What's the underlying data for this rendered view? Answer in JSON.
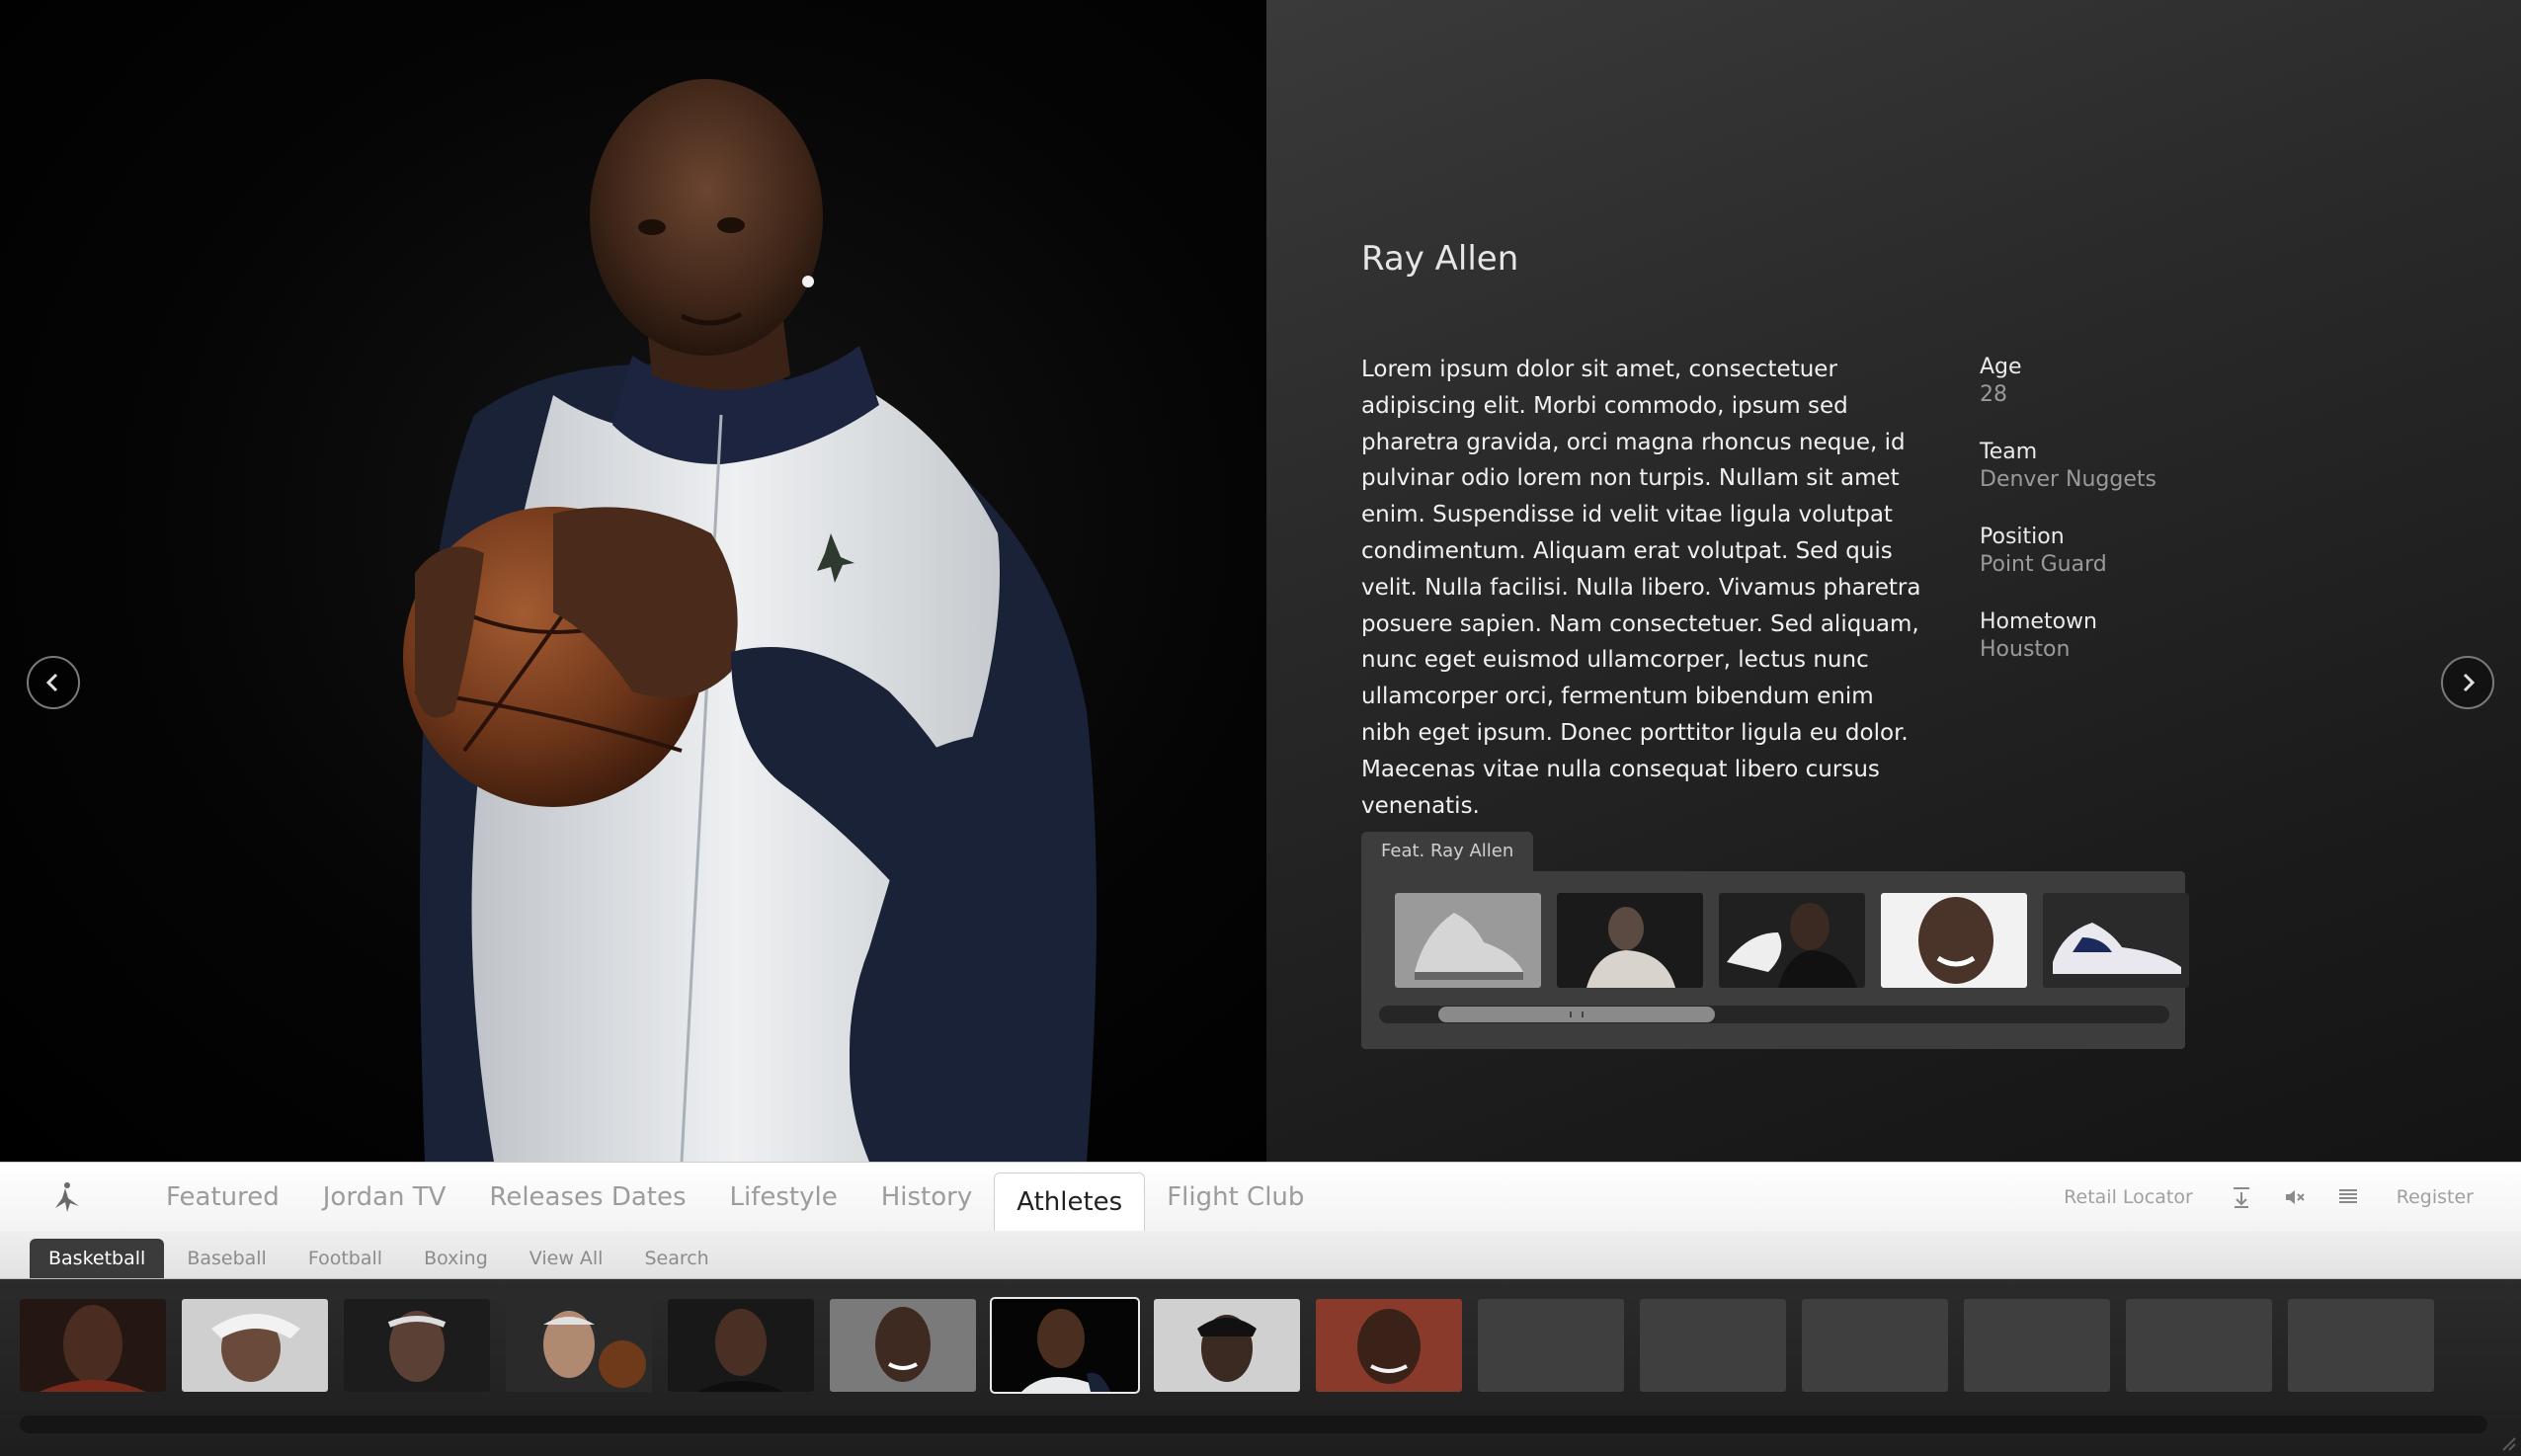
{
  "athlete": {
    "name": "Ray Allen",
    "bio": "Lorem ipsum dolor sit amet, consectetuer adipiscing elit. Morbi commodo, ipsum sed pharetra gravida, orci magna rhoncus neque, id pulvinar odio lorem non turpis. Nullam sit amet enim. Suspendisse id velit vitae ligula volutpat condimentum. Aliquam erat volutpat. Sed quis velit. Nulla facilisi. Nulla libero. Vivamus pharetra posuere sapien. Nam consectetuer. Sed aliquam, nunc eget euismod ullamcorper, lectus nunc ullamcorper orci, fermentum bibendum enim nibh eget ipsum. Donec porttitor ligula eu dolor. Maecenas vitae nulla consequat libero cursus venenatis.",
    "stats": [
      {
        "label": "Age",
        "value": "28"
      },
      {
        "label": "Team",
        "value": "Denver Nuggets"
      },
      {
        "label": "Position",
        "value": "Point Guard"
      },
      {
        "label": "Hometown",
        "value": "Houston"
      }
    ]
  },
  "featured": {
    "tab_label": "Feat. Ray Allen",
    "thumbnails": [
      "shoe-grey-icon",
      "player-portrait",
      "player-holding-shoe",
      "player-smiling",
      "shoe-white-navy-icon"
    ]
  },
  "nav": {
    "logo": "jumpman-logo-icon",
    "items": [
      {
        "label": "Featured",
        "active": false
      },
      {
        "label": "Jordan TV",
        "active": false
      },
      {
        "label": "Releases Dates",
        "active": false
      },
      {
        "label": "Lifestyle",
        "active": false
      },
      {
        "label": "History",
        "active": false
      },
      {
        "label": "Athletes",
        "active": true
      },
      {
        "label": "Flight Club",
        "active": false
      }
    ],
    "retail_locator": "Retail Locator",
    "register": "Register",
    "icons": [
      "download-icon",
      "mute-icon",
      "list-icon"
    ]
  },
  "subnav": {
    "items": [
      {
        "label": "Basketball",
        "active": true
      },
      {
        "label": "Baseball",
        "active": false
      },
      {
        "label": "Football",
        "active": false
      },
      {
        "label": "Boxing",
        "active": false
      },
      {
        "label": "View All",
        "active": false
      },
      {
        "label": "Search",
        "active": false
      }
    ]
  },
  "athlete_strip": {
    "selected_index": 6,
    "filled_count": 9,
    "total_count": 15
  },
  "colors": {
    "accent_dark": "#3b3b3b",
    "panel": "#3d3d3d",
    "nav_bg": "#ffffff",
    "jacket_navy": "#1a2238"
  }
}
